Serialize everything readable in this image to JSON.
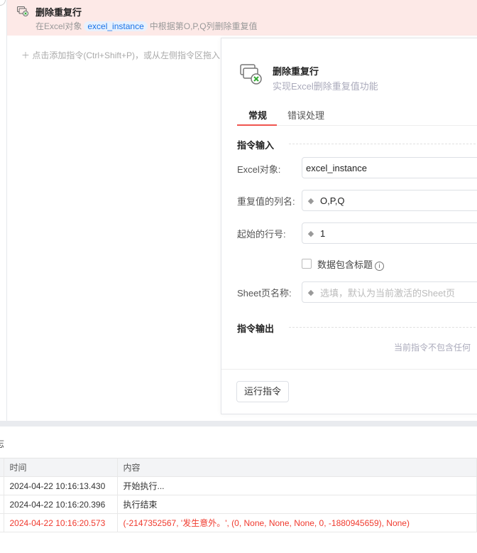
{
  "command": {
    "title": "删除重复行",
    "desc_prefix": "在Excel对象",
    "chip": "excel_instance",
    "desc_suffix": "中根据第O,P,Q列删除重复值"
  },
  "add_hint": "点击添加指令(Ctrl+Shift+P)，或从左侧指令区拖入",
  "panel": {
    "title": "删除重复行",
    "subtitle": "实现Excel删除重复值功能",
    "tabs": [
      "常规",
      "错误处理"
    ],
    "input_section": "指令输入",
    "fields": [
      {
        "label": "Excel对象:",
        "value": "excel_instance"
      },
      {
        "label": "重复值的列名:",
        "value": "O,P,Q"
      },
      {
        "label": "起始的行号:",
        "value": "1"
      },
      {
        "label": "Sheet页名称:",
        "placeholder": "选填，默认为当前激活的Sheet页"
      }
    ],
    "checkbox_label": "数据包含标题",
    "output_section": "指令输出",
    "no_output": "当前指令不包含任何",
    "run_button": "运行指令"
  },
  "log": {
    "title": "志",
    "columns": [
      "时间",
      "内容"
    ],
    "rows": [
      {
        "time": "2024-04-22 10:16:13.430",
        "content": "开始执行..."
      },
      {
        "time": "2024-04-22 10:16:20.396",
        "content": "执行结束"
      },
      {
        "time": "2024-04-22 10:16:20.573",
        "content": "(-2147352567, '发生意外。', (0, None, None, None, 0, -1880945659), None)"
      }
    ]
  },
  "colors": {
    "accent": "#f0544f",
    "error": "#f03a2e",
    "selected_row": "#fde9e7",
    "chip": "#1a73e8"
  }
}
